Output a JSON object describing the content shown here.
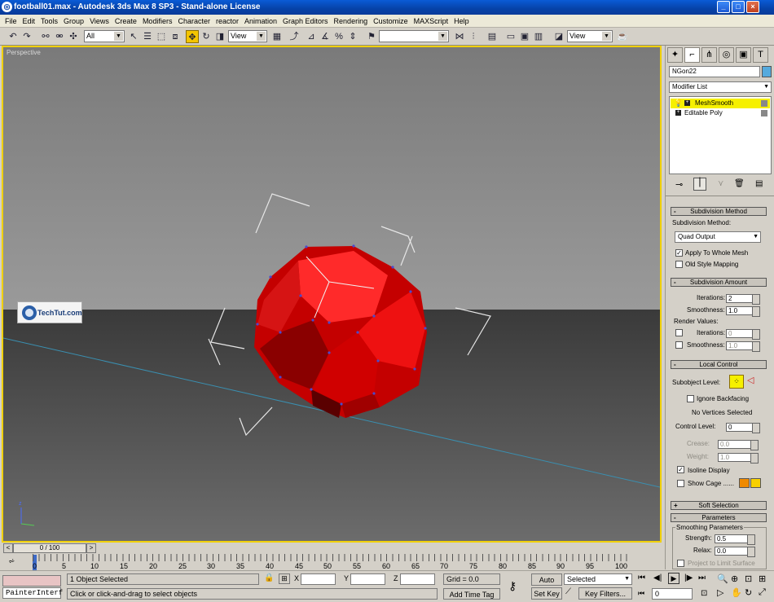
{
  "window": {
    "title": "football01.max - Autodesk 3ds Max 8 SP3 - Stand-alone License",
    "app_icon": "3ds-max-icon"
  },
  "menu": [
    "File",
    "Edit",
    "Tools",
    "Group",
    "Views",
    "Create",
    "Modifiers",
    "Character",
    "reactor",
    "Animation",
    "Graph Editors",
    "Rendering",
    "Customize",
    "MAXScript",
    "Help"
  ],
  "toolbar": {
    "selection_filter": "All",
    "ref_coord": "View",
    "named_selection": "",
    "render_view": "View"
  },
  "viewport": {
    "label": "Perspective",
    "watermark": "TechTut.com"
  },
  "command_panel": {
    "object_name": "NGon22",
    "object_color": "#55aadd",
    "modifier_list_label": "Modifier List",
    "stack": [
      {
        "name": "MeshSmooth",
        "selected": true
      },
      {
        "name": "Editable Poly",
        "selected": false
      }
    ],
    "subdivision_method": {
      "header": "Subdivision Method",
      "label": "Subdivision Method:",
      "value": "Quad Output",
      "apply_whole_mesh": "Apply To Whole Mesh",
      "old_style": "Old Style Mapping"
    },
    "subdivision_amount": {
      "header": "Subdivision Amount",
      "iterations_label": "Iterations:",
      "iterations": "2",
      "smoothness_label": "Smoothness:",
      "smoothness": "1.0",
      "render_values": "Render Values:",
      "r_iterations_label": "Iterations:",
      "r_iterations": "0",
      "r_smoothness_label": "Smoothness:",
      "r_smoothness": "1.0"
    },
    "local_control": {
      "header": "Local Control",
      "subobject_label": "Subobject Level:",
      "ignore_backfacing": "Ignore Backfacing",
      "no_vertices": "No Vertices Selected",
      "control_level_label": "Control Level:",
      "control_level": "0",
      "crease_label": "Crease:",
      "crease": "0.0",
      "weight_label": "Weight:",
      "weight": "1.0",
      "isoline_display": "Isoline Display",
      "show_cage": "Show Cage ......",
      "cage_color_1": "#f08a00",
      "cage_color_2": "#f8d000"
    },
    "soft_selection": {
      "header": "Soft Selection"
    },
    "parameters": {
      "header": "Parameters",
      "group": "Smoothing Parameters",
      "strength_label": "Strength:",
      "strength": "0.5",
      "relax_label": "Relax:",
      "relax": "0.0",
      "project_label": "Project to Limit Surface"
    }
  },
  "timeline": {
    "frame_label": "0 / 100",
    "ticks": [
      "0",
      "5",
      "10",
      "15",
      "20",
      "25",
      "30",
      "35",
      "40",
      "45",
      "50",
      "55",
      "60",
      "65",
      "70",
      "75",
      "80",
      "85",
      "90",
      "95",
      "100"
    ]
  },
  "status": {
    "script_label": "PainterInterf",
    "selection": "1 Object Selected",
    "prompt": "Click or click-and-drag to select objects",
    "x_label": "X",
    "y_label": "Y",
    "z_label": "Z",
    "grid": "Grid = 0.0",
    "add_time_tag": "Add Time Tag",
    "auto_key": "Auto Key",
    "set_key": "Set Key",
    "key_mode": "Selected",
    "key_filters": "Key Filters...",
    "current_frame": "0"
  }
}
